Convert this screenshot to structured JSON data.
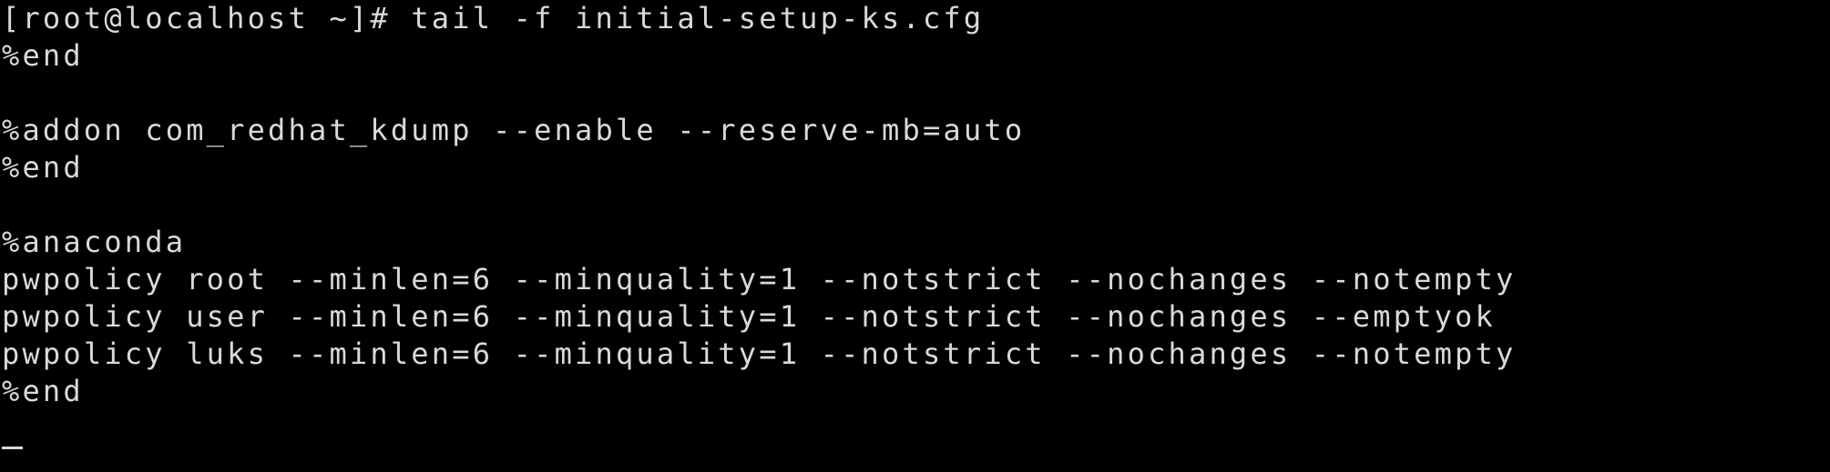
{
  "terminal": {
    "prompt": "[root@localhost ~]# ",
    "command": "tail -f initial-setup-ks.cfg",
    "lines": [
      "%end",
      "",
      "%addon com_redhat_kdump --enable --reserve-mb=auto",
      "%end",
      "",
      "%anaconda",
      "pwpolicy root --minlen=6 --minquality=1 --notstrict --nochanges --notempty",
      "pwpolicy user --minlen=6 --minquality=1 --notstrict --nochanges --emptyok",
      "pwpolicy luks --minlen=6 --minquality=1 --notstrict --nochanges --notempty",
      "%end"
    ]
  }
}
